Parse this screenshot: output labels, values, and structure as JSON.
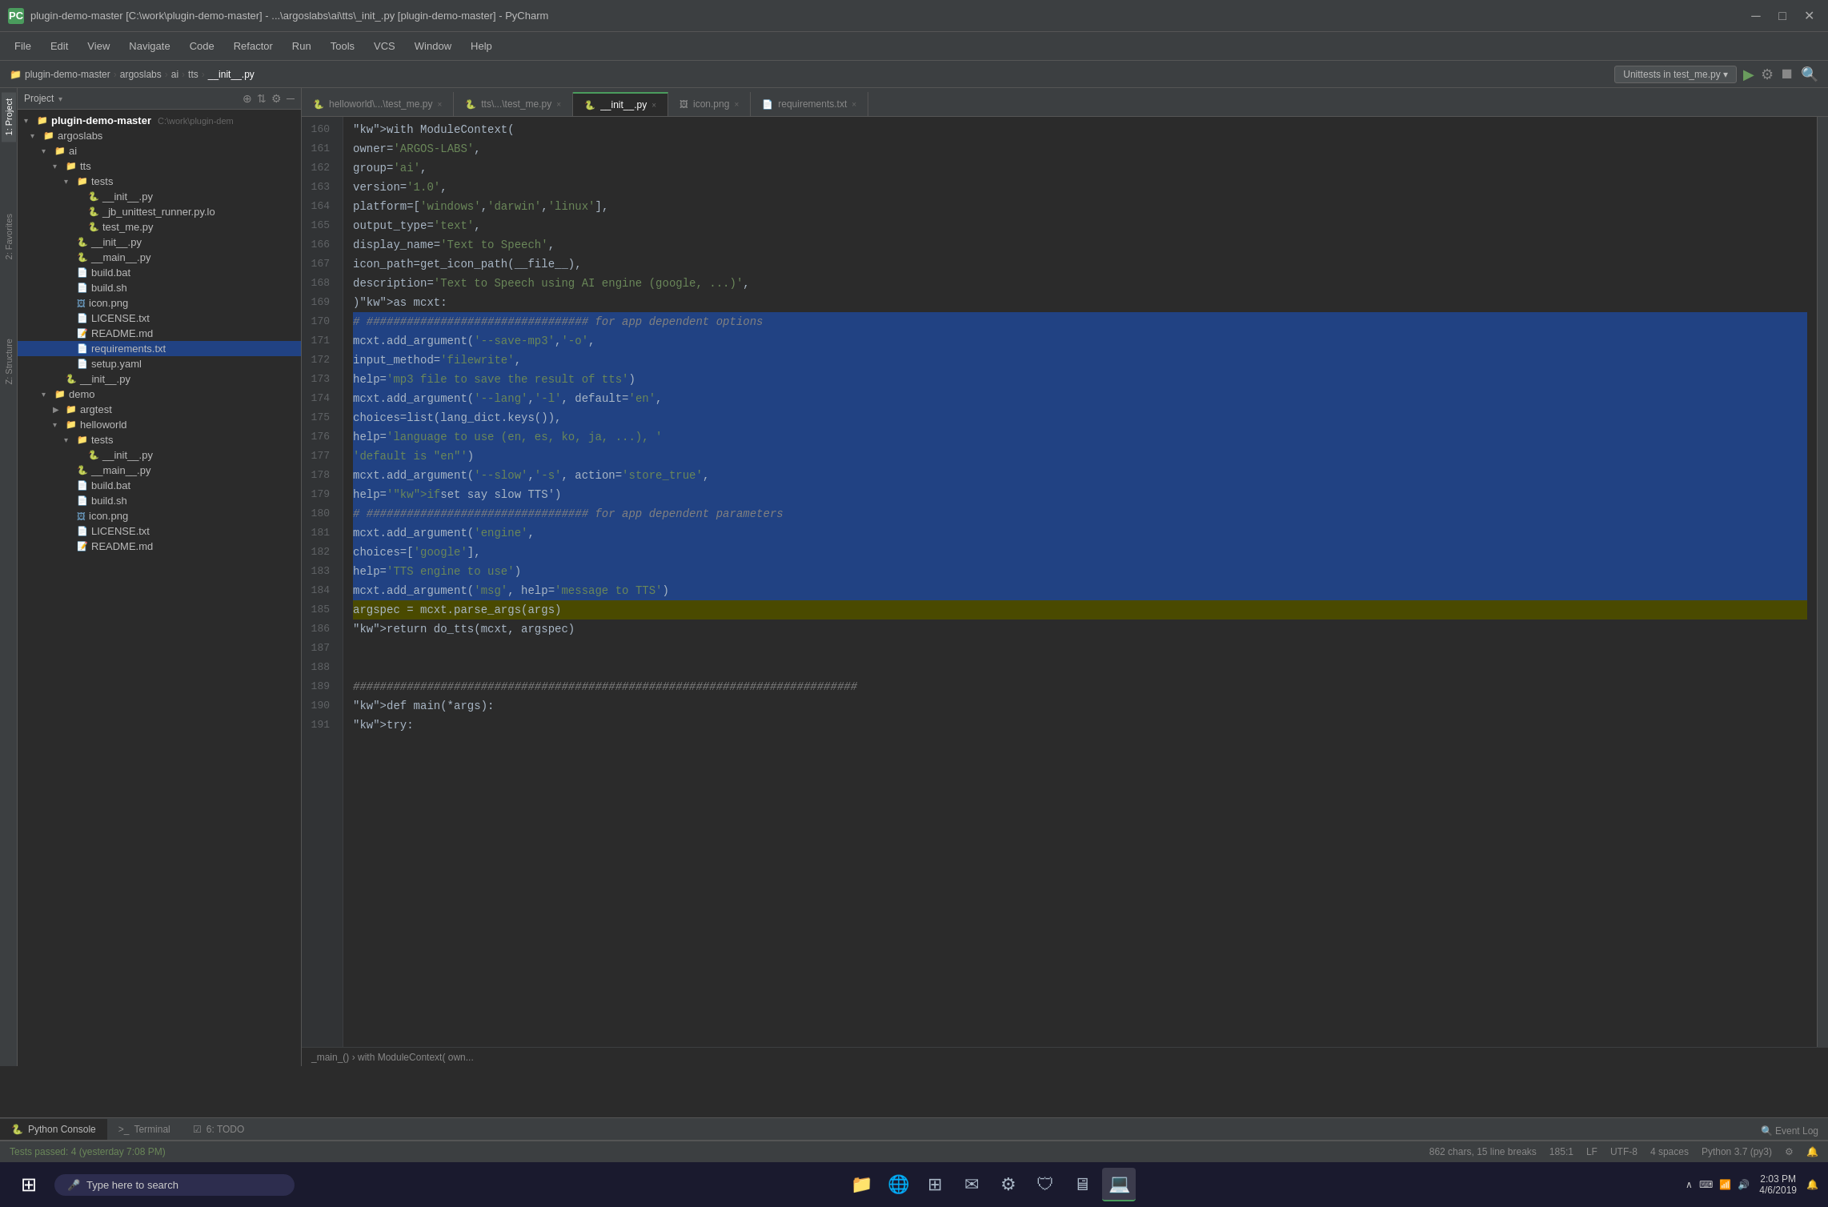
{
  "titlebar": {
    "icon_label": "PC",
    "title": "plugin-demo-master [C:\\work\\plugin-demo-master] - ...\\argoslabs\\ai\\tts\\_init_.py [plugin-demo-master] - PyCharm",
    "minimize_label": "─",
    "maximize_label": "□",
    "close_label": "✕"
  },
  "menubar": {
    "items": [
      "File",
      "Edit",
      "View",
      "Navigate",
      "Code",
      "Refactor",
      "Run",
      "Tools",
      "VCS",
      "Window",
      "Help"
    ]
  },
  "breadcrumb": {
    "items": [
      "plugin-demo-master",
      "argoslabs",
      "ai",
      "tts",
      "__init__.py"
    ],
    "run_config": "Unittests in test_me.py ▾"
  },
  "project_panel": {
    "title": "Project",
    "tree": [
      {
        "id": "root",
        "indent": 0,
        "arrow": "▾",
        "icon": "📁",
        "label": "plugin-demo-master",
        "path": "C:\\work\\plugin-dem",
        "type": "folder"
      },
      {
        "id": "argoslabs",
        "indent": 1,
        "arrow": "▾",
        "icon": "📁",
        "label": "argoslabs",
        "type": "folder"
      },
      {
        "id": "ai",
        "indent": 2,
        "arrow": "▾",
        "icon": "📁",
        "label": "ai",
        "type": "folder"
      },
      {
        "id": "tts",
        "indent": 3,
        "arrow": "▾",
        "icon": "📁",
        "label": "tts",
        "type": "folder"
      },
      {
        "id": "tests",
        "indent": 4,
        "arrow": "▾",
        "icon": "📁",
        "label": "tests",
        "type": "folder"
      },
      {
        "id": "__init__test",
        "indent": 5,
        "arrow": "",
        "icon": "🐍",
        "label": "__init__.py",
        "type": "py"
      },
      {
        "id": "jb_runner",
        "indent": 5,
        "arrow": "",
        "icon": "🐍",
        "label": "_jb_unittest_runner.py.lo",
        "type": "py"
      },
      {
        "id": "test_me",
        "indent": 5,
        "arrow": "",
        "icon": "🐍",
        "label": "test_me.py",
        "type": "py"
      },
      {
        "id": "__init__tts",
        "indent": 4,
        "arrow": "",
        "icon": "🐍",
        "label": "__init__.py",
        "type": "py"
      },
      {
        "id": "__main__tts",
        "indent": 4,
        "arrow": "",
        "icon": "🐍",
        "label": "__main__.py",
        "type": "py"
      },
      {
        "id": "build_bat",
        "indent": 4,
        "arrow": "",
        "icon": "📄",
        "label": "build.bat",
        "type": "bat"
      },
      {
        "id": "build_sh",
        "indent": 4,
        "arrow": "",
        "icon": "📄",
        "label": "build.sh",
        "type": "sh"
      },
      {
        "id": "icon_png",
        "indent": 4,
        "arrow": "",
        "icon": "🖼",
        "label": "icon.png",
        "type": "png"
      },
      {
        "id": "license",
        "indent": 4,
        "arrow": "",
        "icon": "📄",
        "label": "LICENSE.txt",
        "type": "txt"
      },
      {
        "id": "readme",
        "indent": 4,
        "arrow": "",
        "icon": "📝",
        "label": "README.md",
        "type": "md"
      },
      {
        "id": "requirements",
        "indent": 4,
        "arrow": "",
        "icon": "📄",
        "label": "requirements.txt",
        "type": "txt",
        "selected": true
      },
      {
        "id": "setup_yaml",
        "indent": 4,
        "arrow": "",
        "icon": "📄",
        "label": "setup.yaml",
        "type": "yaml"
      },
      {
        "id": "__init__ai",
        "indent": 3,
        "arrow": "",
        "icon": "🐍",
        "label": "__init__.py",
        "type": "py"
      },
      {
        "id": "demo",
        "indent": 2,
        "arrow": "▾",
        "icon": "📁",
        "label": "demo",
        "type": "folder"
      },
      {
        "id": "argtest",
        "indent": 3,
        "arrow": "▶",
        "icon": "📁",
        "label": "argtest",
        "type": "folder"
      },
      {
        "id": "helloworld",
        "indent": 3,
        "arrow": "▾",
        "icon": "📁",
        "label": "helloworld",
        "type": "folder"
      },
      {
        "id": "hw_tests",
        "indent": 4,
        "arrow": "▾",
        "icon": "📁",
        "label": "tests",
        "type": "folder"
      },
      {
        "id": "hw_init",
        "indent": 5,
        "arrow": "",
        "icon": "🐍",
        "label": "__init__.py",
        "type": "py"
      },
      {
        "id": "hw_main",
        "indent": 4,
        "arrow": "",
        "icon": "🐍",
        "label": "__main__.py",
        "type": "py"
      },
      {
        "id": "hw_bat",
        "indent": 4,
        "arrow": "",
        "icon": "📄",
        "label": "build.bat",
        "type": "bat"
      },
      {
        "id": "hw_sh",
        "indent": 4,
        "arrow": "",
        "icon": "📄",
        "label": "build.sh",
        "type": "sh"
      },
      {
        "id": "hw_icon",
        "indent": 4,
        "arrow": "",
        "icon": "🖼",
        "label": "icon.png",
        "type": "png"
      },
      {
        "id": "hw_license",
        "indent": 4,
        "arrow": "",
        "icon": "📄",
        "label": "LICENSE.txt",
        "type": "txt"
      },
      {
        "id": "hw_readme",
        "indent": 4,
        "arrow": "",
        "icon": "📝",
        "label": "README.md",
        "type": "md"
      }
    ]
  },
  "editor_tabs": [
    {
      "id": "tab1",
      "label": "helloworld\\...\\test_me.py",
      "icon": "🐍",
      "active": false,
      "modified": false
    },
    {
      "id": "tab2",
      "label": "tts\\...\\test_me.py",
      "icon": "🐍",
      "active": false,
      "modified": false
    },
    {
      "id": "tab3",
      "label": "__init__.py",
      "icon": "🐍",
      "active": true,
      "modified": false
    },
    {
      "id": "tab4",
      "label": "icon.png",
      "icon": "🖼",
      "active": false,
      "modified": false
    },
    {
      "id": "tab5",
      "label": "requirements.txt",
      "icon": "📄",
      "active": false,
      "modified": false
    }
  ],
  "code_lines": [
    {
      "num": 160,
      "content": "    with ModuleContext(",
      "selected": false
    },
    {
      "num": 161,
      "content": "        owner='ARGOS-LABS',",
      "selected": false
    },
    {
      "num": 162,
      "content": "        group='ai',",
      "selected": false
    },
    {
      "num": 163,
      "content": "        version='1.0',",
      "selected": false
    },
    {
      "num": 164,
      "content": "        platform=['windows', 'darwin', 'linux'],",
      "selected": false
    },
    {
      "num": 165,
      "content": "        output_type='text',",
      "selected": false
    },
    {
      "num": 166,
      "content": "        display_name='Text to Speech',",
      "selected": false
    },
    {
      "num": 167,
      "content": "        icon_path=get_icon_path(__file__),",
      "selected": false
    },
    {
      "num": 168,
      "content": "        description='Text to Speech using AI engine (google, ...)',",
      "selected": false
    },
    {
      "num": 169,
      "content": "    ) as mcxt:",
      "selected": false
    },
    {
      "num": 170,
      "content": "        # ################################# for app dependent options",
      "selected": true
    },
    {
      "num": 171,
      "content": "        mcxt.add_argument('--save-mp3', '-o',",
      "selected": true
    },
    {
      "num": 172,
      "content": "                         input_method='filewrite',",
      "selected": true
    },
    {
      "num": 173,
      "content": "                         help='mp3 file to save the result of tts')",
      "selected": true
    },
    {
      "num": 174,
      "content": "        mcxt.add_argument('--lang', '-l', default='en',",
      "selected": true
    },
    {
      "num": 175,
      "content": "                         choices=list(lang_dict.keys()),",
      "selected": true
    },
    {
      "num": 176,
      "content": "                         help='language to use (en, es, ko, ja, ...), '",
      "selected": true
    },
    {
      "num": 177,
      "content": "                              'default is \"en\"')",
      "selected": true
    },
    {
      "num": 178,
      "content": "        mcxt.add_argument('--slow', '-s', action='store_true',",
      "selected": true
    },
    {
      "num": 179,
      "content": "                         help='if set say slow TTS')",
      "selected": true
    },
    {
      "num": 180,
      "content": "        # ################################# for app dependent parameters",
      "selected": true
    },
    {
      "num": 181,
      "content": "        mcxt.add_argument('engine',",
      "selected": true
    },
    {
      "num": 182,
      "content": "                         choices=['google'],",
      "selected": true
    },
    {
      "num": 183,
      "content": "                         help='TTS engine to use')",
      "selected": true
    },
    {
      "num": 184,
      "content": "        mcxt.add_argument('msg', help='message to TTS')",
      "selected": true
    },
    {
      "num": 185,
      "content": "        argspec = mcxt.parse_args(args)",
      "selected": false,
      "highlight_yellow": true
    },
    {
      "num": 186,
      "content": "        return do_tts(mcxt, argspec)",
      "selected": false
    },
    {
      "num": 187,
      "content": "",
      "selected": false
    },
    {
      "num": 188,
      "content": "",
      "selected": false
    },
    {
      "num": 189,
      "content": "###########################################################################",
      "selected": false
    },
    {
      "num": 190,
      "content": "def main(*args):",
      "selected": false
    },
    {
      "num": 191,
      "content": "    try:",
      "selected": false
    }
  ],
  "editor_breadcrumb": "_main_() › with ModuleContext(    own...",
  "bottom_tabs": [
    {
      "id": "python_console",
      "label": "Python Console",
      "icon": "🐍",
      "active": true
    },
    {
      "id": "terminal",
      "label": "Terminal",
      "icon": ">_",
      "active": false
    },
    {
      "id": "todo",
      "label": "6: TODO",
      "icon": "☑",
      "active": false
    }
  ],
  "status_bar": {
    "left": {
      "tests_status": "Tests passed: 4 (yesterday 7:08 PM)"
    },
    "right": {
      "chars": "862 chars, 15 line breaks",
      "position": "185:1",
      "line_ending": "LF",
      "encoding": "UTF-8",
      "indent": "4 spaces",
      "python": "Python 3.7 (py3)"
    }
  },
  "taskbar": {
    "start_icon": "⊞",
    "search_placeholder": "Type here to search",
    "center_icons": [
      "🪟",
      "🌐",
      "📁",
      "⊞",
      "✉",
      "⚙",
      "🛡",
      "🖥",
      "💻"
    ],
    "time": "2:03 PM",
    "date": "4/6/2019"
  }
}
